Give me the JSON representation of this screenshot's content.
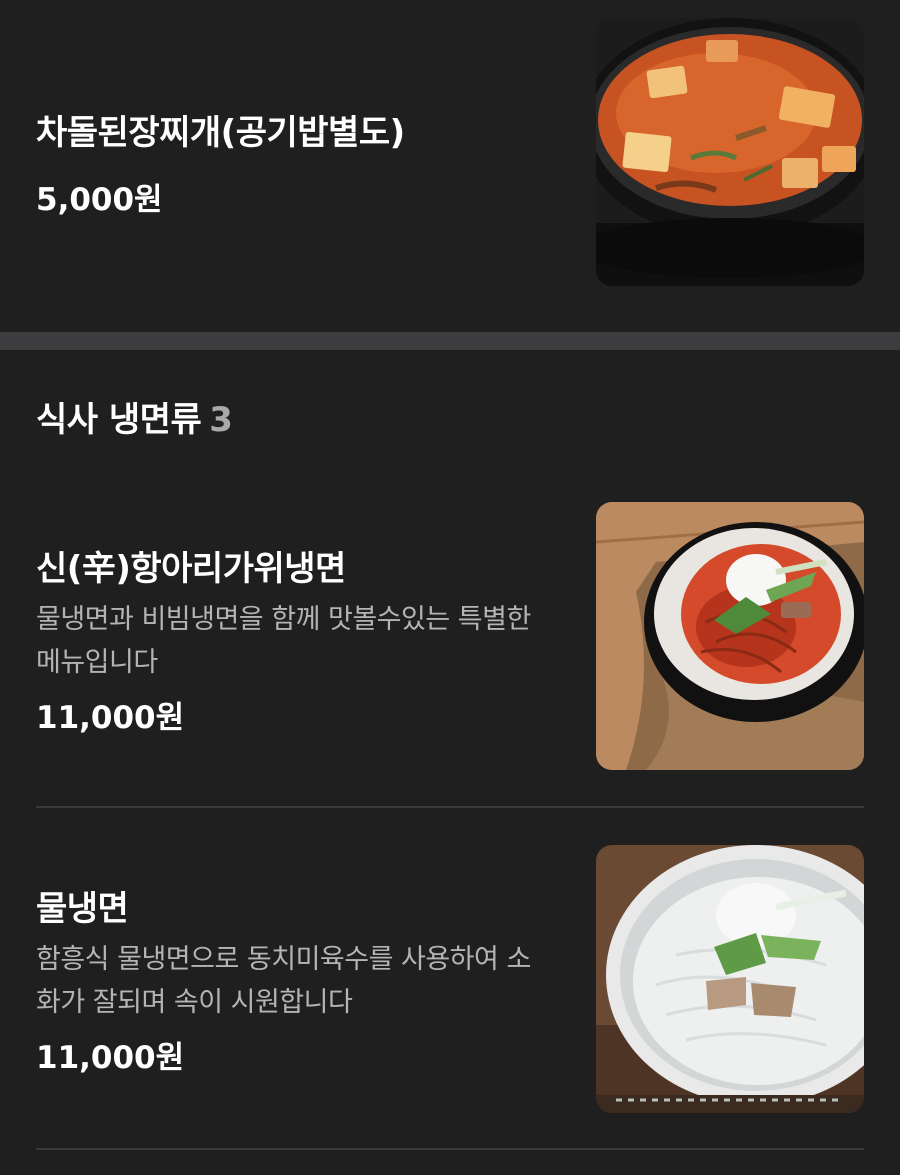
{
  "top_item": {
    "name": "차돌된장찌개(공기밥별도)",
    "price": "5,000원",
    "image_icon": "stew-photo"
  },
  "section": {
    "title": "식사 냉면류",
    "count": "3",
    "items": [
      {
        "name": "신(辛)항아리가위냉면",
        "description": "물냉면과 비빔냉면을 함께 맛볼수있는 특별한 메뉴입니다",
        "price": "11,000원",
        "image_icon": "spicy-cold-noodle-photo"
      },
      {
        "name": "물냉면",
        "description": "함흥식 물냉면으로 동치미육수를 사용하여 소화가 잘되며 속이 시원합니다",
        "price": "11,000원",
        "image_icon": "cold-noodle-photo"
      }
    ]
  },
  "colors": {
    "background": "#1f1f20",
    "section_gap": "#3d3d3f",
    "description_text": "#b4b4b6",
    "divider": "#3a3a3c"
  }
}
